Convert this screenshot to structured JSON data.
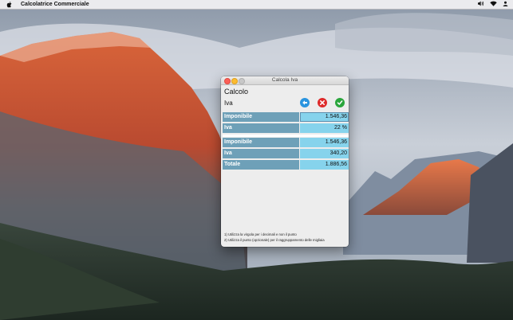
{
  "menubar": {
    "app_name": "Calcolatrice Commerciale"
  },
  "window": {
    "title": "Calcola Iva"
  },
  "header": {
    "title": "Calcolo",
    "subtitle": "Iva"
  },
  "input_rows": [
    {
      "label": "Imponibile",
      "value": "1.546,36"
    },
    {
      "label": "Iva",
      "value": "22 %"
    }
  ],
  "result_rows": [
    {
      "label": "Imponibile",
      "value": "1.546,36"
    },
    {
      "label": "Iva",
      "value": "340,20"
    },
    {
      "label": "Totale",
      "value": "1.886,56"
    }
  ],
  "notes": [
    "1) Utilizza la virgola per i decimali e non il punto",
    "2) Utilizza il punto (opzionale) per il raggruppamento delle migliaia"
  ],
  "colors": {
    "label_bg": "#6ea0b8",
    "value_bg": "#86d3ec",
    "back_button": "#2a94df",
    "cancel_button": "#de2a2a",
    "ok_button": "#2aa63c"
  }
}
